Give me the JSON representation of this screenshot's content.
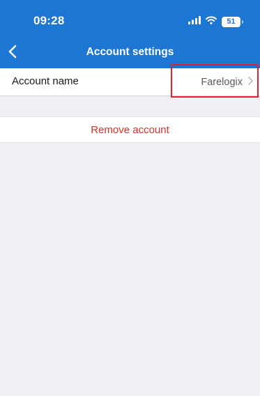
{
  "status_bar": {
    "time": "09:28",
    "battery_level": "51",
    "icons": [
      "signal-icon",
      "wifi-icon",
      "battery-icon"
    ]
  },
  "nav": {
    "back_icon": "chevron-left-icon",
    "title": "Account settings"
  },
  "account_row": {
    "label": "Account name",
    "value": "Farelogix",
    "chevron_icon": "chevron-right-icon"
  },
  "remove_row": {
    "label": "Remove account"
  },
  "colors": {
    "header": "#1e76d3",
    "background": "#efeff4",
    "destructive": "#d9302a",
    "highlight": "#e21f2d"
  }
}
